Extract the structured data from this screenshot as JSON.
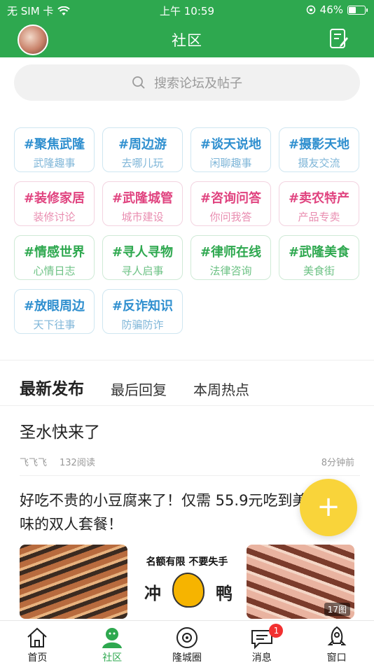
{
  "status": {
    "carrier": "无 SIM 卡",
    "time": "上午 10:59",
    "battery": "46%",
    "battery_level": 0.46
  },
  "header": {
    "title": "社区"
  },
  "search": {
    "placeholder": "搜索论坛及帖子"
  },
  "topics": [
    {
      "title": "#聚焦武隆",
      "sub": "武隆趣事",
      "color": "blue"
    },
    {
      "title": "#周边游",
      "sub": "去哪儿玩",
      "color": "blue"
    },
    {
      "title": "#谈天说地",
      "sub": "闲聊趣事",
      "color": "blue"
    },
    {
      "title": "#摄影天地",
      "sub": "摄友交流",
      "color": "blue"
    },
    {
      "title": "#装修家居",
      "sub": "装修讨论",
      "color": "pink"
    },
    {
      "title": "#武隆城管",
      "sub": "城市建设",
      "color": "pink"
    },
    {
      "title": "#咨询问答",
      "sub": "你问我答",
      "color": "pink"
    },
    {
      "title": "#卖农特产",
      "sub": "产品专卖",
      "color": "pink"
    },
    {
      "title": "#情感世界",
      "sub": "心情日志",
      "color": "green"
    },
    {
      "title": "#寻人寻物",
      "sub": "寻人启事",
      "color": "green"
    },
    {
      "title": "#律师在线",
      "sub": "法律咨询",
      "color": "green"
    },
    {
      "title": "#武隆美食",
      "sub": "美食街",
      "color": "green"
    },
    {
      "title": "#放眼周边",
      "sub": "天下往事",
      "color": "blue"
    },
    {
      "title": "#反诈知识",
      "sub": "防骗防诈",
      "color": "blue"
    }
  ],
  "tabs": [
    {
      "label": "最新发布",
      "active": true
    },
    {
      "label": "最后回复",
      "active": false
    },
    {
      "label": "本周热点",
      "active": false
    }
  ],
  "posts": [
    {
      "title": "圣水快来了",
      "author": "飞飞飞",
      "reads": "132阅读",
      "time": "8分钟前"
    },
    {
      "title": "好吃不贵的小豆腐来了！仅需 55.9元吃到美味的双人套餐！",
      "image_count": "17图",
      "promo": {
        "slogan": "名额有限  不要失手",
        "left": "冲",
        "right": "鸭"
      }
    }
  ],
  "fab": {
    "label": "+"
  },
  "tabbar": [
    {
      "label": "首页",
      "icon": "home-icon",
      "active": false
    },
    {
      "label": "社区",
      "icon": "community-icon",
      "active": true
    },
    {
      "label": "隆城圈",
      "icon": "circle-icon",
      "active": false
    },
    {
      "label": "消息",
      "icon": "message-icon",
      "active": false,
      "badge": "1"
    },
    {
      "label": "窗口",
      "icon": "rocket-icon",
      "active": false
    }
  ],
  "colors": {
    "brand": "#2ea84f",
    "fab": "#f9d43a",
    "badge": "#f23030"
  }
}
